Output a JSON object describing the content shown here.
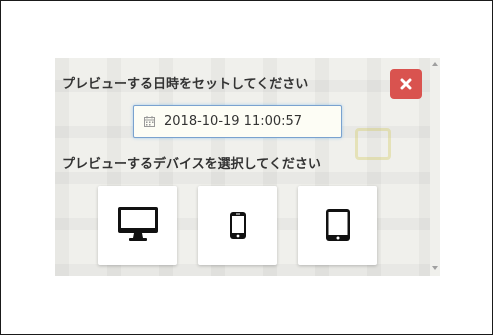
{
  "dialog": {
    "datetime_label": "プレビューする日時をセットしてください",
    "datetime_value": "2018-10-19 11:00:57",
    "device_label": "プレビューするデバイスを選択してください"
  },
  "devices": [
    {
      "name": "desktop",
      "icon": "desktop-icon"
    },
    {
      "name": "smartphone",
      "icon": "smartphone-icon"
    },
    {
      "name": "tablet",
      "icon": "tablet-icon"
    }
  ],
  "icons": {
    "close": "close-icon",
    "calendar": "calendar-icon",
    "scroll_up": "scroll-up-arrow-icon",
    "scroll_down": "scroll-down-arrow-icon"
  },
  "colors": {
    "close_button": "#d9534f",
    "panel_background": "#f0f0ec",
    "input_border": "#7aa2cf",
    "text": "#333333"
  }
}
